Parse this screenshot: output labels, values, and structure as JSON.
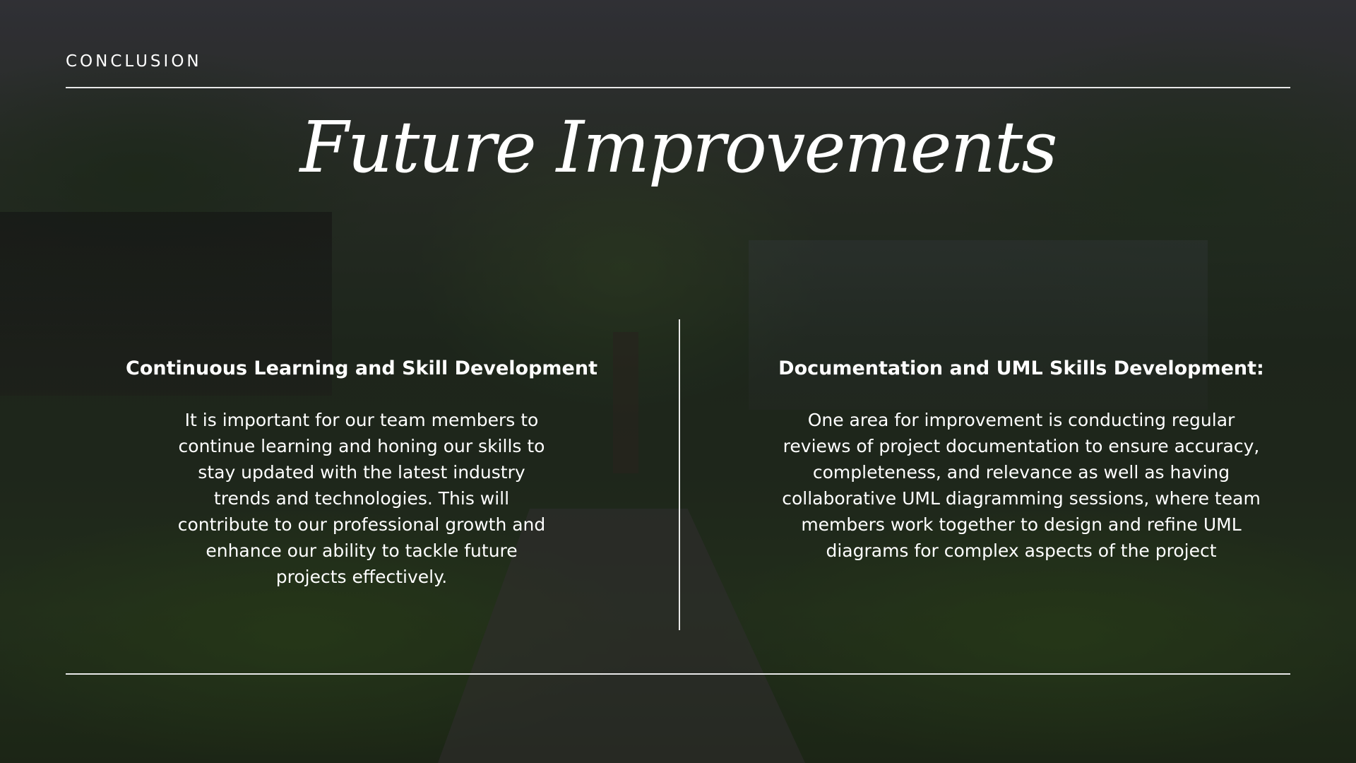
{
  "slide": {
    "section_label": "CONCLUSION",
    "title": "Future Improvements",
    "background_description_colors": {
      "overlay": "#000000",
      "text": "#ffffff",
      "rules": "#e8e8e8"
    },
    "columns": [
      {
        "heading": "Continuous Learning and Skill Development",
        "body": "It is important for our team members to continue learning and honing our skills to stay updated with the latest industry trends and technologies. This will contribute to our professional growth and enhance our ability to tackle future projects effectively."
      },
      {
        "heading": "Documentation and UML Skills Development:",
        "body": "One area for improvement is conducting regular reviews of project documentation to ensure accuracy, completeness, and relevance as well as having collaborative UML diagramming sessions, where team members work together to design and refine UML diagrams for complex aspects of the project"
      }
    ]
  }
}
